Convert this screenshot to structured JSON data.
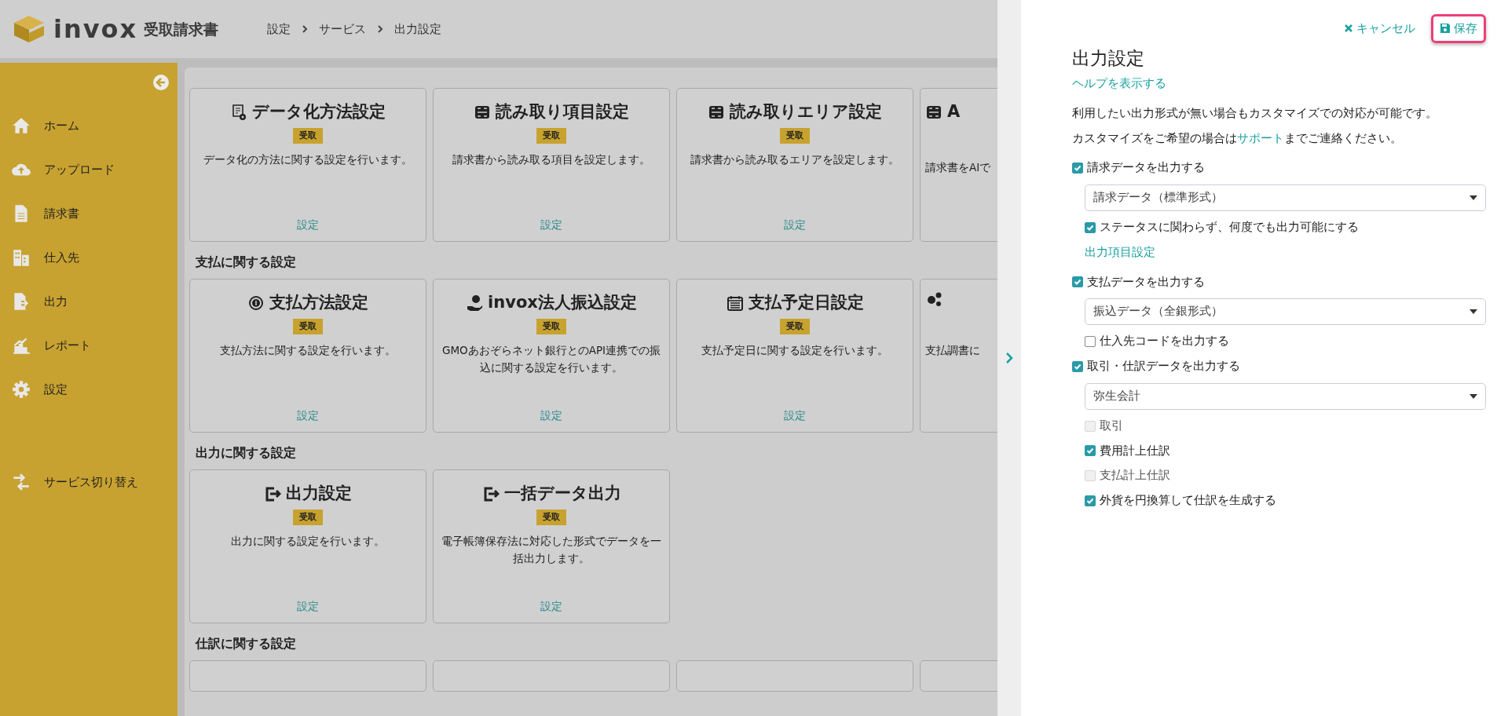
{
  "header": {
    "logo_word": "invox",
    "product": "受取請求書",
    "breadcrumbs": [
      "設定",
      "サービス",
      "出力設定"
    ]
  },
  "sidebar": {
    "items": [
      {
        "label": "ホーム"
      },
      {
        "label": "アップロード"
      },
      {
        "label": "請求書"
      },
      {
        "label": "仕入先"
      },
      {
        "label": "出力"
      },
      {
        "label": "レポート"
      },
      {
        "label": "設定"
      }
    ],
    "footer_item": {
      "label": "サービス切り替え"
    }
  },
  "sections": [
    {
      "cards": [
        {
          "title": "データ化方法設定",
          "tag": "受取",
          "description": "データ化の方法に関する設定を行います。",
          "link": "設定"
        },
        {
          "title": "読み取り項目設定",
          "tag": "受取",
          "description": "請求書から読み取る項目を設定します。",
          "link": "設定"
        },
        {
          "title": "読み取りエリア設定",
          "tag": "受取",
          "description": "請求書から読み取るエリアを設定します。",
          "link": "設定"
        },
        {
          "title": "A",
          "description": "請求書をAIで"
        }
      ]
    },
    {
      "title": "支払に関する設定",
      "cards": [
        {
          "title": "支払方法設定",
          "tag": "受取",
          "description": "支払方法に関する設定を行います。",
          "link": "設定"
        },
        {
          "title": "invox法人振込設定",
          "tag": "受取",
          "description": "GMOあおぞらネット銀行とのAPI連携での振込に関する設定を行います。",
          "link": "設定"
        },
        {
          "title": "支払予定日設定",
          "tag": "受取",
          "description": "支払予定日に関する設定を行います。",
          "link": "設定"
        },
        {
          "description": "支払調書に"
        }
      ]
    },
    {
      "title": "出力に関する設定",
      "cards": [
        {
          "title": "出力設定",
          "tag": "受取",
          "description": "出力に関する設定を行います。",
          "link": "設定"
        },
        {
          "title": "一括データ出力",
          "tag": "受取",
          "description": "電子帳簿保存法に対応した形式でデータを一括出力します。",
          "link": "設定"
        }
      ]
    },
    {
      "title": "仕訳に関する設定"
    }
  ],
  "panel": {
    "cancel": "キャンセル",
    "save": "保存",
    "title": "出力設定",
    "help_link": "ヘルプを表示する",
    "notes": [
      {
        "text": "利用したい出力形式が無い場合もカスタマイズでの対応が可能です。"
      },
      {
        "before": "カスタマイズをご希望の場合は",
        "link": "サポート",
        "after": "までご連絡ください。"
      }
    ],
    "options": [
      {
        "kind": "checkbox",
        "label": "請求データを出力する",
        "checked": true,
        "disabled": false,
        "children": [
          {
            "kind": "select",
            "value": "請求データ（標準形式）"
          },
          {
            "kind": "checkbox",
            "label": "ステータスに関わらず、何度でも出力可能にする",
            "checked": true,
            "disabled": false
          },
          {
            "kind": "link",
            "label": "出力項目設定"
          }
        ]
      },
      {
        "kind": "checkbox",
        "label": "支払データを出力する",
        "checked": true,
        "disabled": false,
        "children": [
          {
            "kind": "select",
            "value": "振込データ（全銀形式）"
          },
          {
            "kind": "checkbox",
            "label": "仕入先コードを出力する",
            "checked": false,
            "disabled": false
          }
        ]
      },
      {
        "kind": "checkbox",
        "label": "取引・仕訳データを出力する",
        "checked": true,
        "disabled": false,
        "children": [
          {
            "kind": "select",
            "value": "弥生会計"
          },
          {
            "kind": "checkbox",
            "label": "取引",
            "checked": false,
            "disabled": true
          },
          {
            "kind": "checkbox",
            "label": "費用計上仕訳",
            "checked": true,
            "disabled": false
          },
          {
            "kind": "checkbox",
            "label": "支払計上仕訳",
            "checked": false,
            "disabled": true
          },
          {
            "kind": "checkbox",
            "label": "外貨を円換算して仕訳を生成する",
            "checked": true,
            "disabled": false
          }
        ]
      }
    ]
  }
}
